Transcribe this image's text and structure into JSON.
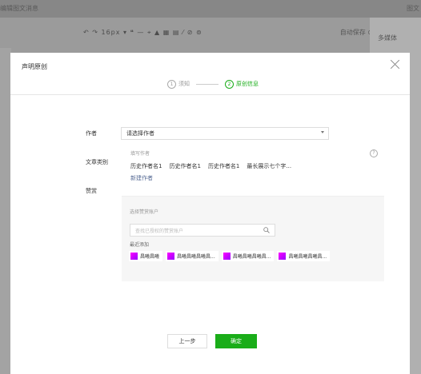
{
  "background": {
    "doc_title": "编辑图文消息",
    "doc_title_right": "图文",
    "toolbar_tools": "↶ ↷  16px ▾  ❝  —  ⌖  ▲  ▦  ▤  ⁄  ⊘  ⊚",
    "autosave": "自动保存 ⊙",
    "multimedia": "多媒体"
  },
  "modal": {
    "title": "声明原创",
    "steps": [
      {
        "num": "1",
        "label": "须知"
      },
      {
        "num": "2",
        "label": "原创信息"
      }
    ],
    "form": {
      "author_label": "作者",
      "author_select": "请选择作者",
      "category_label": "文章类别",
      "reward_label": "赞赏"
    },
    "author_dropdown": {
      "header": "填写作者",
      "authors": [
        "历史作者名1",
        "历史作者名1",
        "历史作者名1",
        "最长展示七个字..."
      ],
      "new_author": "新建作者"
    },
    "reward_panel": {
      "header": "选择赞赏账户",
      "search_placeholder": "查找已授权的赞赏账户",
      "recent_label": "最近添加",
      "accounts": [
        "昌曦昌曦",
        "昌曦昌曦昌曦昌...",
        "昌曦昌曦昌曦昌...",
        "昌曦昌曦昌曦昌..."
      ]
    },
    "buttons": {
      "prev": "上一步",
      "confirm": "确定"
    }
  },
  "colors": {
    "accent": "#1aad19",
    "link": "#576b95"
  }
}
